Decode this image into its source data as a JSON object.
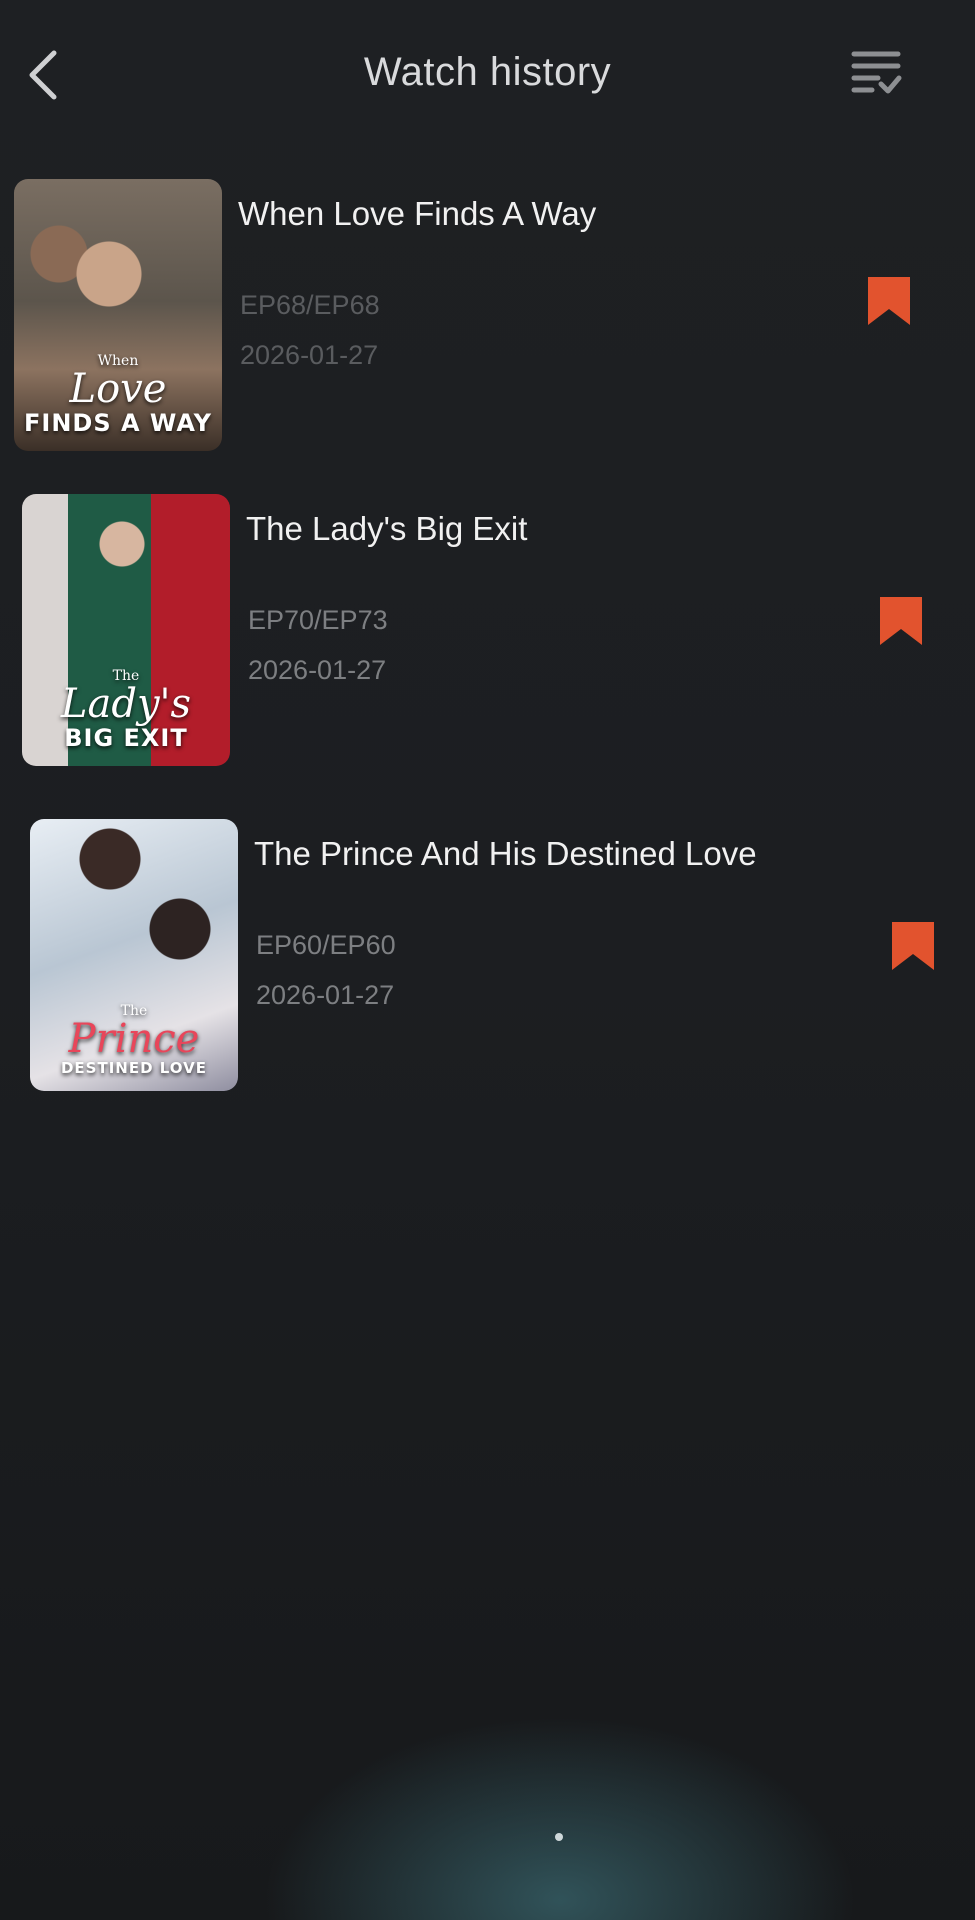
{
  "header": {
    "title": "Watch history",
    "back_icon": "chevron-left-icon",
    "manage_icon": "list-check-icon"
  },
  "accent_color": "#e2532e",
  "history": [
    {
      "title": "When Love Finds A Way",
      "episode": "EP68/EP68",
      "date": "2026-01-27",
      "poster_text": {
        "small": "When",
        "script": "Love",
        "big": "FINDS A WAY"
      }
    },
    {
      "title": "The Lady's Big Exit",
      "episode": "EP70/EP73",
      "date": "2026-01-27",
      "poster_text": {
        "small": "The",
        "script": "Lady's",
        "big": "BIG EXIT"
      }
    },
    {
      "title": "The Prince And His Destined Love",
      "episode": "EP60/EP60",
      "date": "2026-01-27",
      "poster_text": {
        "small": "The",
        "script": "Prince",
        "big": "DESTINED LOVE"
      }
    }
  ]
}
